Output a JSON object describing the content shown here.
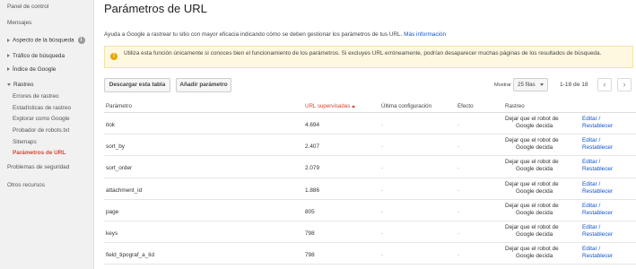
{
  "sidebar": {
    "items": [
      {
        "label": "Panel de control",
        "level": 0,
        "arrow": ""
      },
      {
        "label": "Mensajes",
        "level": 0,
        "arrow": ""
      },
      {
        "label": "Aspecto de la búsqueda",
        "level": 0,
        "arrow": "right",
        "info": "i"
      },
      {
        "label": "Tráfico de búsqueda",
        "level": 0,
        "arrow": "right"
      },
      {
        "label": "Índice de Google",
        "level": 0,
        "arrow": "right"
      },
      {
        "label": "Rastreo",
        "level": 0,
        "arrow": "down"
      },
      {
        "label": "Errores de rastreo",
        "level": 1
      },
      {
        "label": "Estadísticas de rastreo",
        "level": 1
      },
      {
        "label": "Explorar como Google",
        "level": 1
      },
      {
        "label": "Probador de robots.txt",
        "level": 1
      },
      {
        "label": "Sitemaps",
        "level": 1
      },
      {
        "label": "Parámetros de URL",
        "level": 1,
        "active": true
      },
      {
        "label": "Problemas de seguridad",
        "level": 0
      },
      {
        "label": "Otros recursos",
        "level": 0
      }
    ]
  },
  "page": {
    "title": "Parámetros de URL",
    "intro": "Ayuda a Google a rastrear tu sitio con mayor eficacia indicando cómo se deben gestionar los parámetros de tus URL.",
    "intro_link": "Más información",
    "warning": "Utiliza esta función únicamente si conoces bien el funcionamiento de los parámetros. Si excluyes URL erróneamente, podrían desaparecer muchas páginas de los resultados de búsqueda."
  },
  "toolbar": {
    "download_label": "Descargar esta tabla",
    "add_label": "Añadir parámetro",
    "show_label": "Mostrar",
    "rows_value": "25 filas",
    "range": "1-18 de 18",
    "prev_icon": "‹",
    "next_icon": "›"
  },
  "table": {
    "headers": {
      "param": "Parámetro",
      "urls": "URL supervisadas",
      "last": "Última configuración",
      "effect": "Efecto",
      "crawl": "Rastreo"
    },
    "rows": [
      {
        "param": "itok",
        "urls": "4.694",
        "last": "-",
        "effect": "-",
        "crawl1": "Dejar que el robot de",
        "crawl2": "Google decida",
        "act1": "Editar /",
        "act2": "Restablecer"
      },
      {
        "param": "sort_by",
        "urls": "2.407",
        "last": "-",
        "effect": "-",
        "crawl1": "Dejar que el robot de",
        "crawl2": "Google decida",
        "act1": "Editar /",
        "act2": "Restablecer"
      },
      {
        "param": "sort_order",
        "urls": "2.079",
        "last": "-",
        "effect": "-",
        "crawl1": "Dejar que el robot de",
        "crawl2": "Google decida",
        "act1": "Editar /",
        "act2": "Restablecer"
      },
      {
        "param": "attachment_id",
        "urls": "1.886",
        "last": "-",
        "effect": "-",
        "crawl1": "Dejar que el robot de",
        "crawl2": "Google decida",
        "act1": "Editar /",
        "act2": "Restablecer"
      },
      {
        "param": "page",
        "urls": "805",
        "last": "-",
        "effect": "-",
        "crawl1": "Dejar que el robot de",
        "crawl2": "Google decida",
        "act1": "Editar /",
        "act2": "Restablecer"
      },
      {
        "param": "keys",
        "urls": "798",
        "last": "-",
        "effect": "-",
        "crawl1": "Dejar que el robot de",
        "crawl2": "Google decida",
        "act1": "Editar /",
        "act2": "Restablecer"
      },
      {
        "param": "field_tipograf_a_tid",
        "urls": "798",
        "last": "-",
        "effect": "-",
        "crawl1": "Dejar que el robot de",
        "crawl2": "Google decida",
        "act1": "Editar /",
        "act2": "Restablecer"
      }
    ]
  },
  "colors": {
    "accent": "#d14836",
    "link": "#1155cc",
    "warning_bg": "#fff8e1",
    "warning_icon": "#e8a400"
  }
}
